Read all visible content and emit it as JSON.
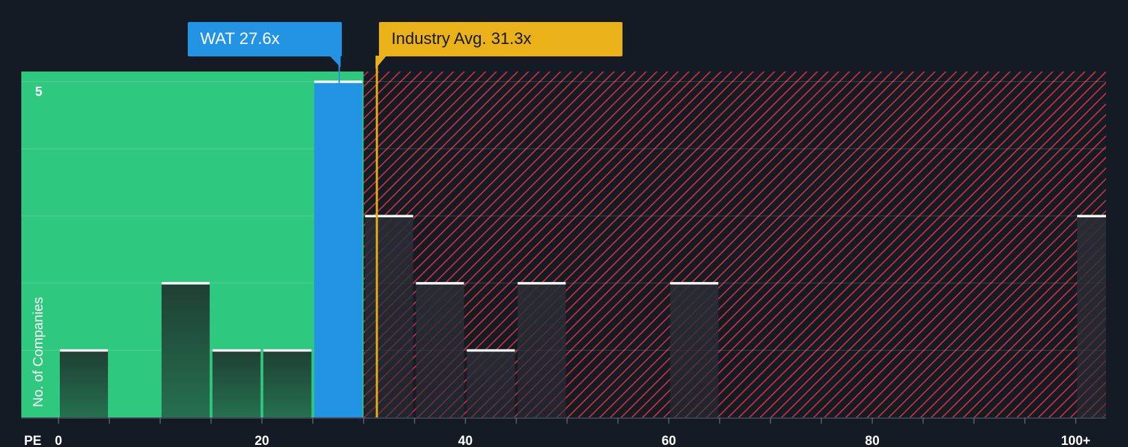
{
  "chart_data": {
    "type": "bar",
    "xlabel": "PE",
    "ylabel": "No. of Companies",
    "xlim": [
      -5,
      102.5
    ],
    "ylim": [
      0,
      5.15
    ],
    "x_ticks": [
      {
        "value": 0,
        "label": "0"
      },
      {
        "value": 20,
        "label": "20"
      },
      {
        "value": 40,
        "label": "40"
      },
      {
        "value": 60,
        "label": "60"
      },
      {
        "value": 80,
        "label": "80"
      },
      {
        "value": 100,
        "label": "100+"
      }
    ],
    "y_ticks": [
      {
        "value": 5,
        "label": "5"
      }
    ],
    "bin_width": 5,
    "bins": [
      {
        "x0": 0,
        "x1": 5,
        "value": 1
      },
      {
        "x0": 10,
        "x1": 15,
        "value": 2
      },
      {
        "x0": 15,
        "x1": 20,
        "value": 1
      },
      {
        "x0": 20,
        "x1": 25,
        "value": 1
      },
      {
        "x0": 25,
        "x1": 30,
        "value": 5,
        "highlight": true
      },
      {
        "x0": 30,
        "x1": 35,
        "value": 3
      },
      {
        "x0": 35,
        "x1": 40,
        "value": 2
      },
      {
        "x0": 40,
        "x1": 45,
        "value": 1
      },
      {
        "x0": 45,
        "x1": 50,
        "value": 2
      },
      {
        "x0": 60,
        "x1": 65,
        "value": 2
      },
      {
        "x0": 100,
        "x1": 105,
        "value": 3
      }
    ],
    "company": {
      "ticker": "WAT",
      "value": 27.6,
      "label": "WAT 27.6x"
    },
    "industry_avg": {
      "value": 31.3,
      "label": "Industry Avg. 31.3x"
    },
    "fair_region_end": 30,
    "colors": {
      "background": "#151b24",
      "undervalued": "#2ec97f",
      "overvalued_hatch": "#c8343a",
      "company": "#2394e3",
      "industry": "#eab118",
      "bar_green_zone": "#1f4a3a",
      "bar_red_zone": "#262a34",
      "bar_top": "#ffffff"
    }
  }
}
